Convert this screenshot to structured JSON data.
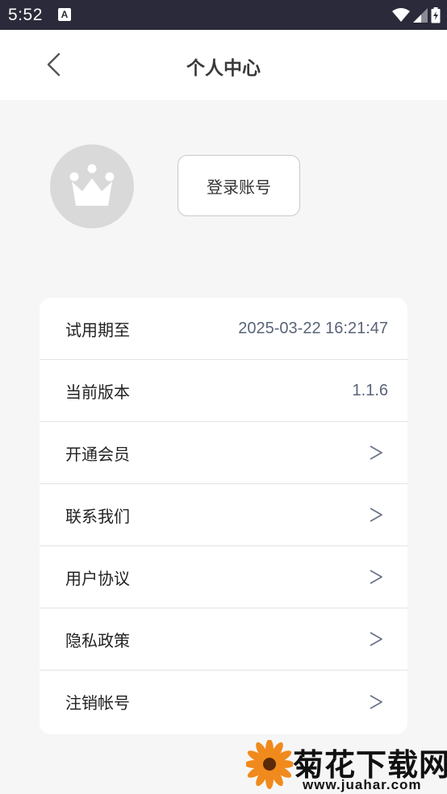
{
  "status_bar": {
    "time": "5:52",
    "notification_icon": "A",
    "icons": [
      "wifi-icon",
      "signal-icon",
      "battery-icon"
    ]
  },
  "header": {
    "back_icon": "chevron-left-icon",
    "title": "个人中心"
  },
  "profile": {
    "avatar_icon": "crown-icon",
    "login_label": "登录账号"
  },
  "menu": {
    "items": [
      {
        "label": "试用期至",
        "value": "2025-03-22 16:21:47"
      },
      {
        "label": "当前版本",
        "value": "1.1.6"
      },
      {
        "label": "开通会员",
        "value": ">"
      },
      {
        "label": "联系我们",
        "value": ">"
      },
      {
        "label": "用户协议",
        "value": ">"
      },
      {
        "label": "隐私政策",
        "value": ">"
      },
      {
        "label": "注销帐号",
        "value": ">"
      }
    ]
  },
  "watermark": {
    "brand": "菊花下载网",
    "url": "www.juahar.com"
  },
  "colors": {
    "status_bar": "#2a2a3a",
    "page_bg": "#f6f6f7",
    "value_text": "#5a6478",
    "chevron": "#6a7388"
  }
}
